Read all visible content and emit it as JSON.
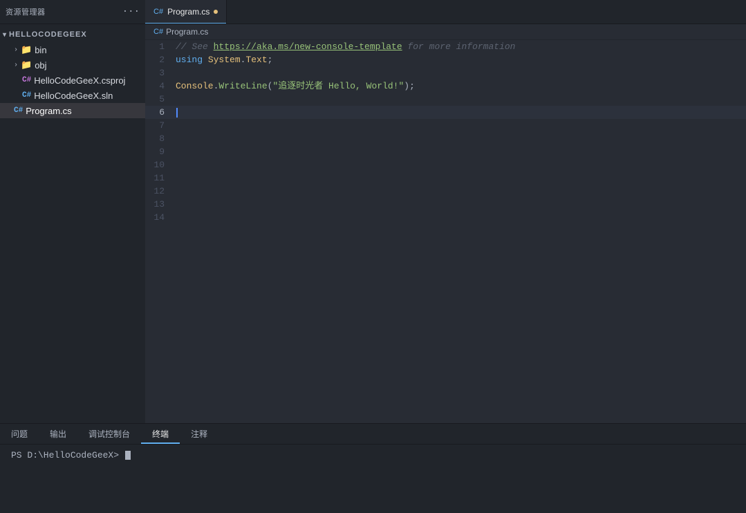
{
  "sidebar": {
    "title": "资源管理器",
    "dots_label": "···",
    "root_label": "HELLOCODEGEEX",
    "items": [
      {
        "id": "bin",
        "label": "bin",
        "type": "folder",
        "depth": 1,
        "expanded": false
      },
      {
        "id": "obj",
        "label": "obj",
        "type": "folder",
        "depth": 1,
        "expanded": false
      },
      {
        "id": "HelloCodeGeeX.csproj",
        "label": "HelloCodeGeeX.csproj",
        "type": "csproj",
        "depth": 2,
        "expanded": false
      },
      {
        "id": "HelloCodeGeeX.sln",
        "label": "HelloCodeGeeX.sln",
        "type": "sln",
        "depth": 2,
        "expanded": false
      },
      {
        "id": "Program.cs",
        "label": "Program.cs",
        "type": "cs",
        "depth": 1,
        "expanded": false,
        "selected": true
      }
    ]
  },
  "tab": {
    "icon": "C#",
    "label": "Program.cs",
    "modified": true
  },
  "breadcrumb": {
    "icon": "C#",
    "label": "Program.cs"
  },
  "code_lines": [
    {
      "num": 1,
      "tokens": [
        {
          "type": "comment",
          "text": "// See "
        },
        {
          "type": "link",
          "text": "https://aka.ms/new-console-template"
        },
        {
          "type": "comment",
          "text": " for more information"
        }
      ]
    },
    {
      "num": 2,
      "tokens": [
        {
          "type": "keyword",
          "text": "using"
        },
        {
          "type": "plain",
          "text": " "
        },
        {
          "type": "class",
          "text": "System"
        },
        {
          "type": "plain",
          "text": "."
        },
        {
          "type": "class",
          "text": "Text"
        },
        {
          "type": "plain",
          "text": ";"
        }
      ]
    },
    {
      "num": 3,
      "tokens": []
    },
    {
      "num": 4,
      "tokens": [
        {
          "type": "class",
          "text": "Console"
        },
        {
          "type": "plain",
          "text": "."
        },
        {
          "type": "method",
          "text": "WriteLine"
        },
        {
          "type": "plain",
          "text": "("
        },
        {
          "type": "string",
          "text": "\"追逐时光者 Hello, World!\""
        },
        {
          "type": "plain",
          "text": ");"
        }
      ]
    },
    {
      "num": 5,
      "tokens": []
    },
    {
      "num": 6,
      "tokens": [
        {
          "type": "cursor",
          "text": ""
        }
      ],
      "active": true
    },
    {
      "num": 7,
      "tokens": []
    },
    {
      "num": 8,
      "tokens": []
    },
    {
      "num": 9,
      "tokens": []
    },
    {
      "num": 10,
      "tokens": []
    },
    {
      "num": 11,
      "tokens": []
    },
    {
      "num": 12,
      "tokens": []
    },
    {
      "num": 13,
      "tokens": []
    },
    {
      "num": 14,
      "tokens": []
    }
  ],
  "bottom_panel": {
    "tabs": [
      {
        "label": "问题",
        "active": false
      },
      {
        "label": "输出",
        "active": false
      },
      {
        "label": "调试控制台",
        "active": false
      },
      {
        "label": "终端",
        "active": true
      },
      {
        "label": "注释",
        "active": false
      }
    ],
    "terminal_prompt": "PS D:\\HelloCodeGeeX> "
  }
}
